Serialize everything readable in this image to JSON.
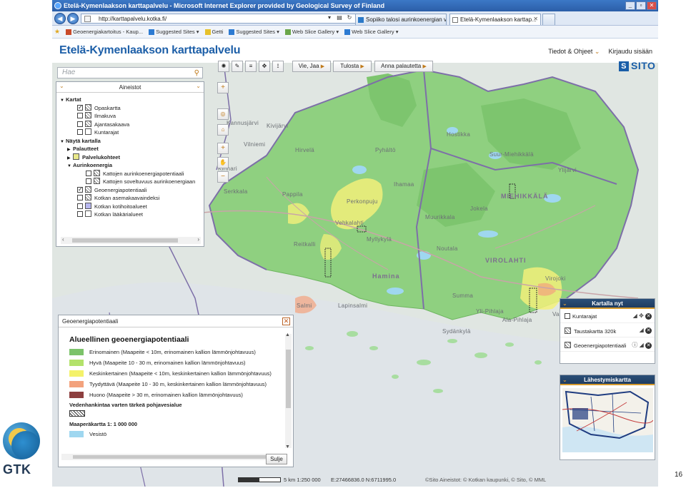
{
  "window": {
    "title": "Etelä-Kymenlaakson karttapalvelu - Microsoft Internet Explorer provided by Geological Survey of Finland",
    "url": "http://karttapalvelu.kotka.fi/",
    "tabs": [
      {
        "label": "Sopiiko talosi aurinkoenergian v..."
      },
      {
        "label": "Etelä-Kymenlaakson karttap..."
      }
    ]
  },
  "favorites": [
    {
      "label": "Geoenergiakartoitus - Kaup..."
    },
    {
      "label": "Suggested Sites ▾"
    },
    {
      "label": "Getti"
    },
    {
      "label": "Suggested Sites ▾"
    },
    {
      "label": "Web Slice Gallery ▾"
    },
    {
      "label": "Web Slice Gallery ▾"
    }
  ],
  "app": {
    "title": "Etelä-Kymenlaakson karttapalvelu",
    "links": [
      "Tiedot & Ohjeet",
      "Kirjaudu sisään"
    ],
    "brand": "SITO"
  },
  "search": {
    "placeholder": "Hae"
  },
  "toolbar": {
    "buttons": [
      "Vie, Jaa",
      "Tulosta",
      "Anna palautetta"
    ]
  },
  "layers": {
    "header": "Aineistot",
    "items": [
      {
        "label": "Kartat",
        "kind": "group"
      },
      {
        "label": "Opaskartta",
        "checked": true
      },
      {
        "label": "Ilmakuva",
        "checked": false
      },
      {
        "label": "Ajantasakaava",
        "checked": false
      },
      {
        "label": "Kuntarajat",
        "checked": false
      },
      {
        "label": "Näytä kartalla",
        "kind": "group"
      },
      {
        "label": "Palautteet",
        "kind": "subgroup"
      },
      {
        "label": "Palvelukohteet",
        "kind": "subgroup"
      },
      {
        "label": "Aurinkoenergia",
        "kind": "subgroup-open"
      },
      {
        "label": "Kattojen aurinkoenergiapotentiaali",
        "checked": false
      },
      {
        "label": "Kattojen soveltuvuus aurinkoenergiaan",
        "checked": false
      },
      {
        "label": "Geoenergiapotentiaali",
        "checked": true
      },
      {
        "label": "Kotkan asemakaavaindeksi",
        "checked": false
      },
      {
        "label": "Kotkan kotihoitoalueet",
        "checked": false
      },
      {
        "label": "Kotkan lääkärialueet",
        "checked": false
      }
    ]
  },
  "legend": {
    "title": "Geoenergiapotentiaali",
    "heading": "Alueellinen geoenergiapotentiaali",
    "entries": [
      {
        "label": "Erinomainen (Maapeite < 10m, erinomainen kallion lämmönjohtavuus)",
        "color": "#7cc36a"
      },
      {
        "label": "Hyvä (Maapeite 10 - 30 m, erinomainen kallion lämmönjohtavuus)",
        "color": "#b3e26b"
      },
      {
        "label": "Keskinkertainen (Maapeite < 10m, keskinkertainen kallion lämmönjohtavuus)",
        "color": "#f4f26a"
      },
      {
        "label": "Tyydyttävä (Maapeite 10 - 30 m, keskinkertainen kallion lämmönjohtavuus)",
        "color": "#f3a27d"
      },
      {
        "label": "Huono (Maapeite > 30 m, erinomainen kallion lämmönjohtavuus)",
        "color": "#8d3f3f"
      }
    ],
    "groundwater_label": "Vedenhankintaa varten tärkeä pohjavesialue",
    "soilmap_label": "Maaperäkartta 1: 1 000 000",
    "water_label": "Vesistö",
    "water_color": "#9fd7f0",
    "close_label": "Sulje"
  },
  "onmap": {
    "title": "Kartalla nyt",
    "rows": [
      "Kuntarajat",
      "Taustakartta 320k",
      "Geoenergiapotentiaali"
    ]
  },
  "overview": {
    "title": "Lähestymiskartta"
  },
  "map": {
    "labels": [
      "Pyhältö",
      "Ihamaa",
      "Perkonpuju",
      "Vehkalahti",
      "Hamina",
      "MIEHIKKÄLÄ",
      "VIROLAHTI",
      "Suur-Miehikkälä",
      "Muurikkala",
      "Ylijärvi",
      "Virojoki",
      "Reitkalli",
      "Myllykylä",
      "Salmi",
      "Sydänkylä",
      "Hirvelä",
      "Vilniemi",
      "Noutala",
      "Summa",
      "Yli-Pihlaja",
      "Ala-Pihlaja",
      "Vaalimaa",
      "Jokela",
      "Lapinsalmi",
      "Hostikka",
      "Serkkala",
      "Kinnari",
      "Kivijärvi",
      "Pappila",
      "Kannusjärvi"
    ],
    "status": {
      "scale": "5 km 1:250 000",
      "coords": "E:27466836.0 N:6711995.0",
      "attribution": "©Sito Aineistot: © Kotkan kaupunki, © Sito, © MML"
    }
  },
  "footer": {
    "logo_text": "GTK",
    "page_number": "16"
  }
}
